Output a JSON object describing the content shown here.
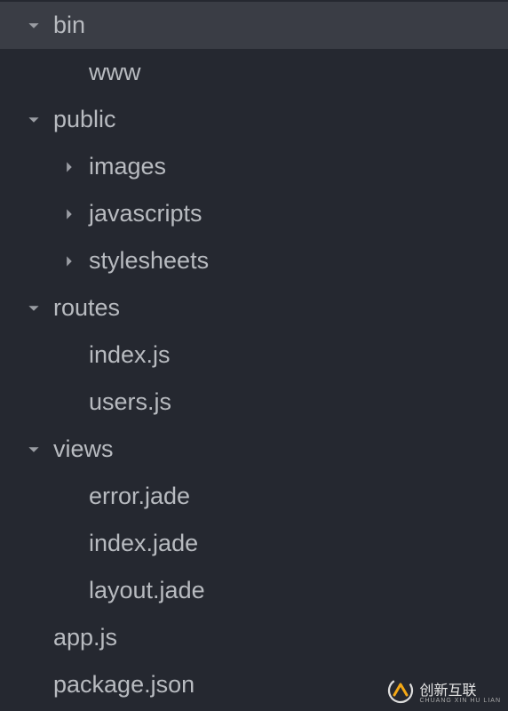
{
  "tree": [
    {
      "label": "bin",
      "indent": 0,
      "arrow": "down",
      "selected": true
    },
    {
      "label": "www",
      "indent": 1,
      "arrow": null,
      "selected": false
    },
    {
      "label": "public",
      "indent": 0,
      "arrow": "down",
      "selected": false
    },
    {
      "label": "images",
      "indent": 2,
      "arrow": "right",
      "selected": false
    },
    {
      "label": "javascripts",
      "indent": 2,
      "arrow": "right",
      "selected": false
    },
    {
      "label": "stylesheets",
      "indent": 2,
      "arrow": "right",
      "selected": false
    },
    {
      "label": "routes",
      "indent": 0,
      "arrow": "down",
      "selected": false
    },
    {
      "label": "index.js",
      "indent": 1,
      "arrow": null,
      "selected": false
    },
    {
      "label": "users.js",
      "indent": 1,
      "arrow": null,
      "selected": false
    },
    {
      "label": "views",
      "indent": 0,
      "arrow": "down",
      "selected": false
    },
    {
      "label": "error.jade",
      "indent": 1,
      "arrow": null,
      "selected": false
    },
    {
      "label": "index.jade",
      "indent": 1,
      "arrow": null,
      "selected": false
    },
    {
      "label": "layout.jade",
      "indent": 1,
      "arrow": null,
      "selected": false
    },
    {
      "label": "app.js",
      "indent": 0,
      "arrow": null,
      "selected": false
    },
    {
      "label": "package.json",
      "indent": 0,
      "arrow": null,
      "selected": false
    }
  ],
  "watermark": {
    "text": "创新互联",
    "sub": "CHUANG XIN HU LIAN"
  }
}
